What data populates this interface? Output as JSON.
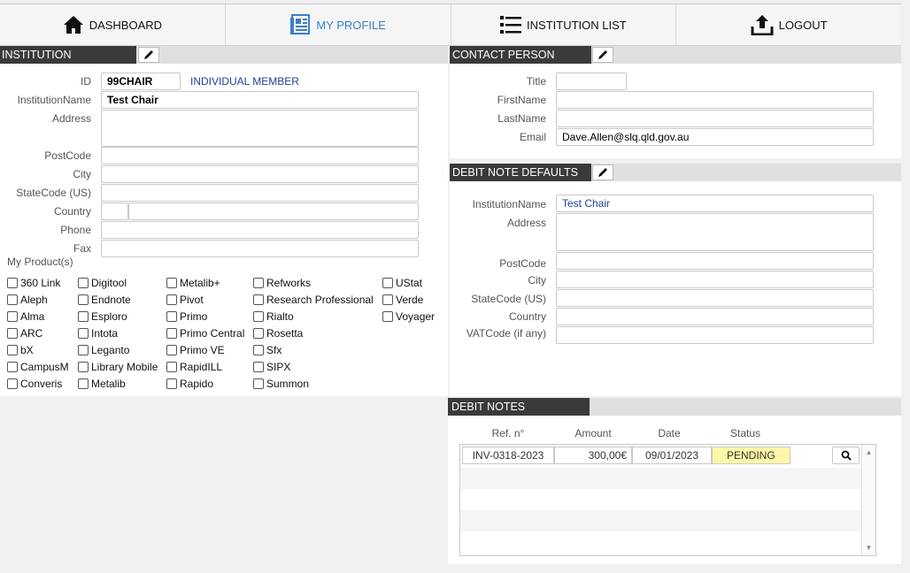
{
  "nav": {
    "dashboard": "DASHBOARD",
    "profile": "MY PROFILE",
    "institutions": "INSTITUTION LIST",
    "logout": "LOGOUT"
  },
  "institution": {
    "header": "INSTITUTION",
    "labels": {
      "id": "ID",
      "name": "InstitutionName",
      "address": "Address",
      "postcode": "PostCode",
      "city": "City",
      "state": "StateCode (US)",
      "country": "Country",
      "phone": "Phone",
      "fax": "Fax"
    },
    "values": {
      "id": "99CHAIR",
      "member_type": "INDIVIDUAL MEMBER",
      "name": "Test Chair",
      "address": "",
      "postcode": "",
      "city": "",
      "state": "",
      "country_code": "",
      "country": "",
      "phone": "",
      "fax": ""
    },
    "products_label": "My Product(s)",
    "products": [
      [
        "360 Link",
        "Aleph",
        "Alma",
        "ARC",
        "bX",
        "CampusM",
        "Converis"
      ],
      [
        "Digitool",
        "Endnote",
        "Esploro",
        "Intota",
        "Leganto",
        "Library Mobile",
        "Metalib"
      ],
      [
        "Metalib+",
        "Pivot",
        "Primo",
        "Primo Central",
        "Primo VE",
        "RapidILL",
        "Rapido"
      ],
      [
        "Refworks",
        "Research Professional",
        "Rialto",
        "Rosetta",
        "Sfx",
        "SIPX",
        "Summon"
      ],
      [
        "UStat",
        "Verde",
        "Voyager"
      ]
    ]
  },
  "contact": {
    "header": "CONTACT PERSON",
    "labels": {
      "title": "Title",
      "first": "FirstName",
      "last": "LastName",
      "email": "Email"
    },
    "values": {
      "title": "",
      "first": "",
      "last": "",
      "email": "Dave.Allen@slq.qld.gov.au"
    }
  },
  "debit_defaults": {
    "header": "DEBIT NOTE DEFAULTS",
    "labels": {
      "name": "InstitutionName",
      "address": "Address",
      "postcode": "PostCode",
      "city": "City",
      "state": "StateCode (US)",
      "country": "Country",
      "vat": "VATCode (if any)"
    },
    "values": {
      "name": "Test Chair",
      "address": "",
      "postcode": "",
      "city": "",
      "state": "",
      "country": "",
      "vat": ""
    }
  },
  "debit_notes": {
    "header": "DEBIT NOTES",
    "columns": [
      "Ref. n°",
      "Amount",
      "Date",
      "Status"
    ],
    "rows": [
      {
        "ref": "INV-0318-2023",
        "amount": "300,00€",
        "date": "09/01/2023",
        "status": "PENDING"
      }
    ]
  },
  "colors": {
    "header_bg": "#3a3a3a",
    "active_nav": "#3a7fc8",
    "pending_bg": "#fff7a8",
    "link_blue": "#1f3f9a"
  }
}
